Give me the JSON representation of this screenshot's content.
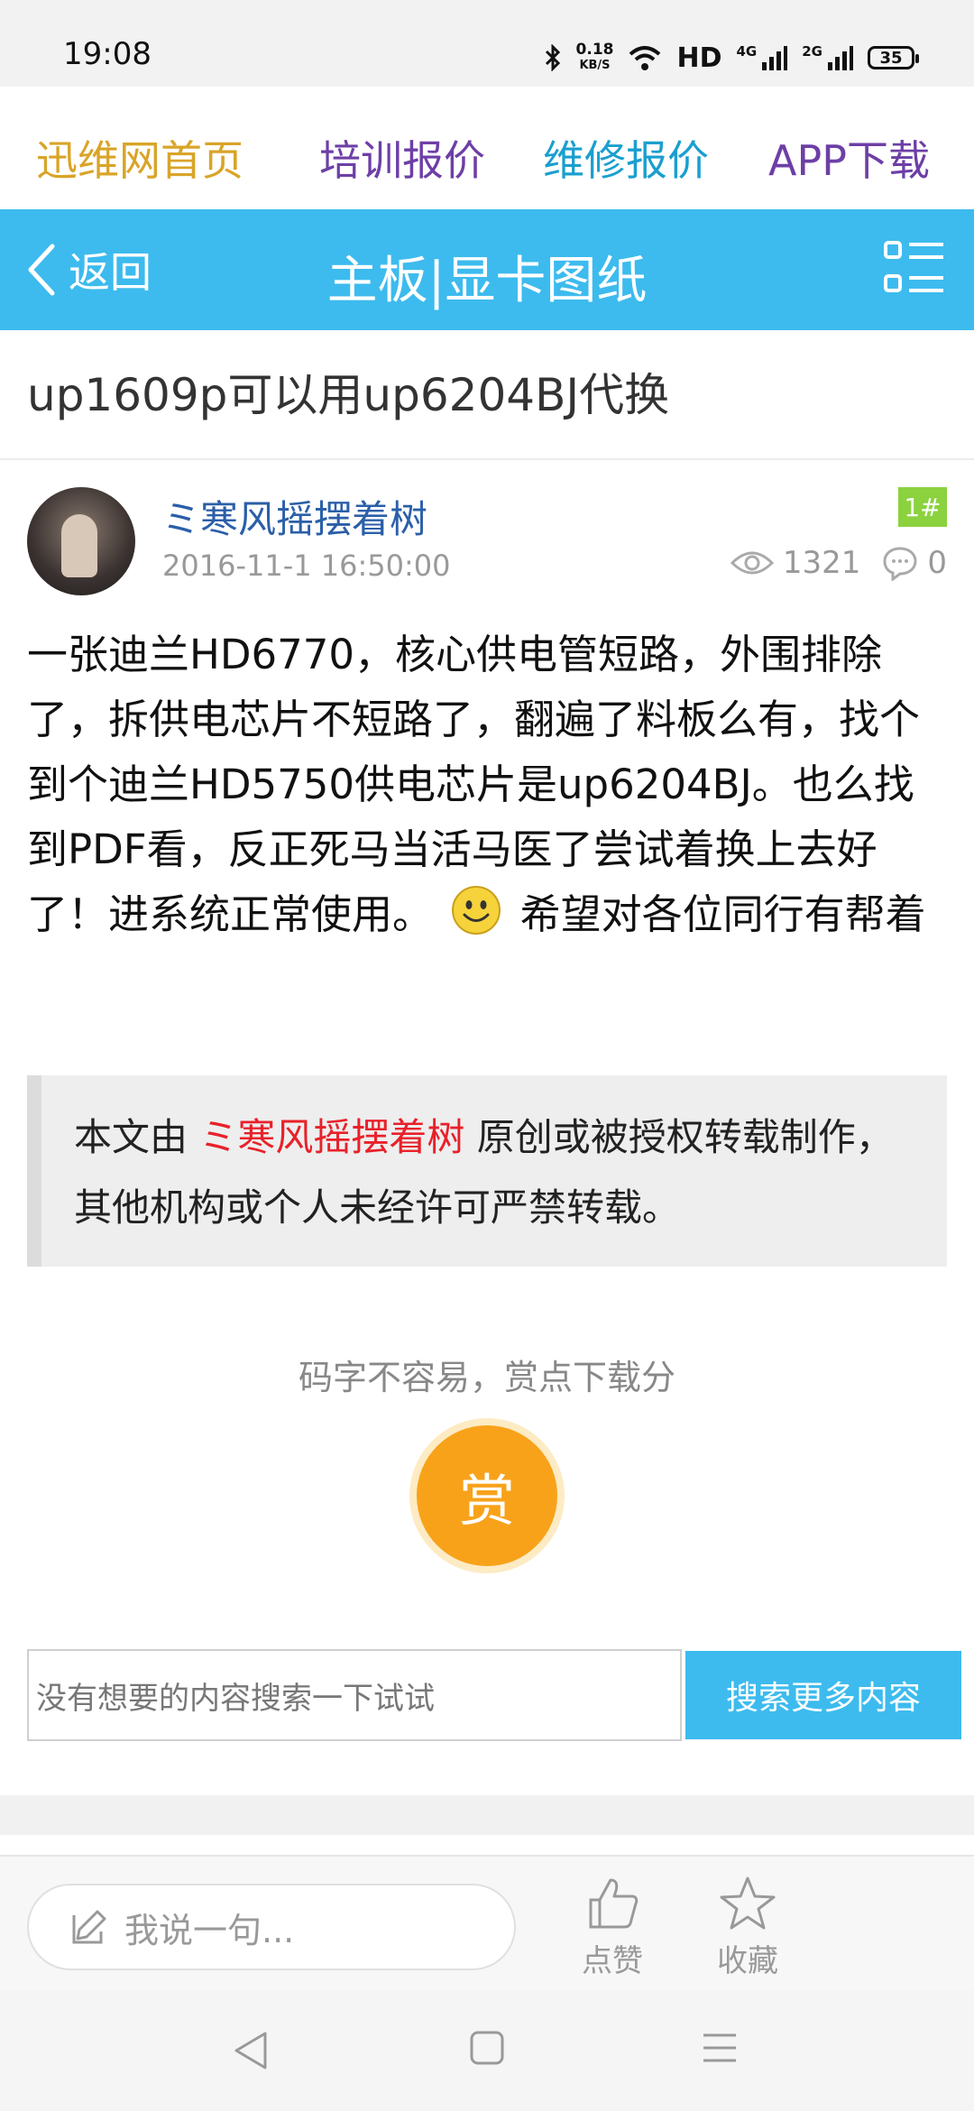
{
  "status_bar": {
    "time": "19:08",
    "speed_value": "0.18",
    "speed_unit": "KB/S",
    "network": "HD",
    "sim1": "4G",
    "sim2": "2G",
    "battery": "35"
  },
  "top_nav": {
    "items": [
      {
        "label": "迅维网首页",
        "color": "#d9a428"
      },
      {
        "label": "培训报价",
        "color": "#6d3fa6"
      },
      {
        "label": "维修报价",
        "color": "#1a9fcf"
      },
      {
        "label": "APP下载",
        "color": "#6d3fa6"
      }
    ]
  },
  "header": {
    "back_label": "返回",
    "title": "主板|显卡图纸",
    "icons": {
      "back": "chevron-left-icon",
      "menu": "list-menu-icon"
    }
  },
  "article": {
    "title": "up1609p可以用up6204BJ代换",
    "author": "ミ寒风摇摆着树",
    "time": "2016-11-1 16:50:00",
    "floor": "1#",
    "views": "1321",
    "comments": "0",
    "body_before_emoji": "一张迪兰HD6770，核心供电管短路，外围排除了，拆供电芯片不短路了，翻遍了料板么有，找个到个迪兰HD5750供电芯片是up6204BJ。也么找到PDF看，反正死马当活马医了尝试着换上去好了！进系统正常使用。",
    "body_after_emoji": "希望对各位同行有帮着"
  },
  "notice": {
    "prefix": "本文由 ",
    "author": "ミ寒风摇摆着树",
    "suffix": " 原创或被授权转载制作，其他机构或个人未经许可严禁转载。"
  },
  "reward": {
    "hint": "码字不容易，赏点下载分",
    "button_label": "赏"
  },
  "search": {
    "placeholder": "没有想要的内容搜索一下试试",
    "button_label": "搜索更多内容"
  },
  "bottom_bar": {
    "comment_placeholder": "我说一句...",
    "like_label": "点赞",
    "favorite_label": "收藏"
  },
  "colors": {
    "brand_blue": "#3dbbee",
    "reward_orange": "#f8a21a",
    "author_red": "#e8212a",
    "author_blue": "#2b5fa8"
  }
}
